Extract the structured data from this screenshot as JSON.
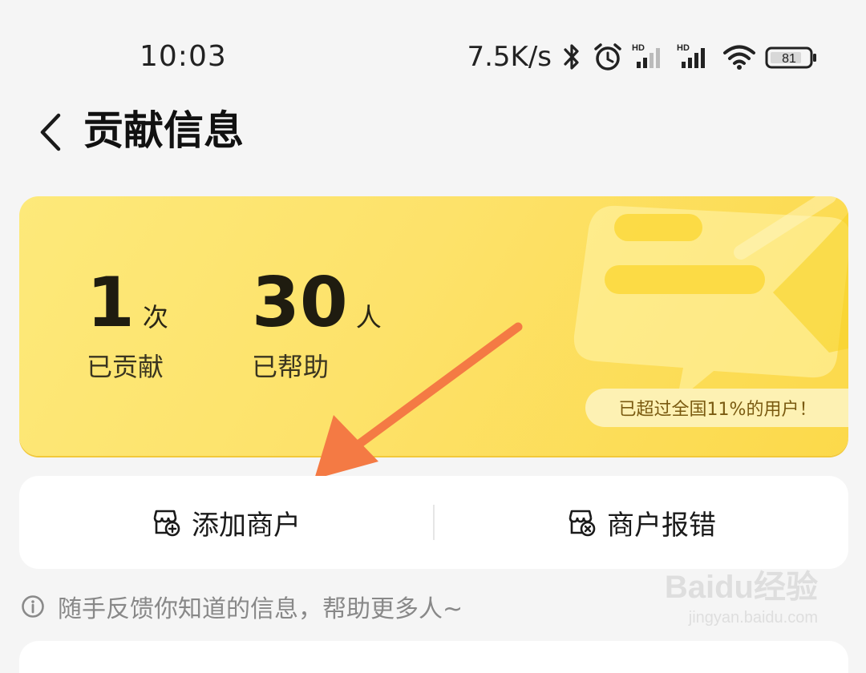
{
  "status_bar": {
    "time": "10:03",
    "net_speed": "7.5K/s",
    "battery": "81",
    "icons": [
      "bluetooth-icon",
      "alarm-icon",
      "signal-hd-icon",
      "signal-hd-icon",
      "wifi-icon",
      "battery-icon"
    ]
  },
  "header": {
    "title": "贡献信息",
    "back_icon": "chevron-left-icon"
  },
  "stats": {
    "contributions": {
      "value": "1",
      "unit": "次",
      "label": "已贡献"
    },
    "helped": {
      "value": "30",
      "unit": "人",
      "label": "已帮助"
    },
    "rank_text": "已超过全国11%的用户！"
  },
  "actions": {
    "add_merchant": {
      "label": "添加商户",
      "icon": "store-add-icon"
    },
    "report_error": {
      "label": "商户报错",
      "icon": "store-error-icon"
    }
  },
  "tip": {
    "text": "随手反馈你知道的信息，帮助更多人~",
    "icon": "info-icon"
  },
  "watermark": {
    "main": "Baidu经验",
    "sub": "jingyan.baidu.com"
  },
  "colors": {
    "card_yellow": "#fde26a",
    "arrow": "#f47a44",
    "badge_bg": "#fdf1b3",
    "badge_text": "#7a5a10"
  }
}
